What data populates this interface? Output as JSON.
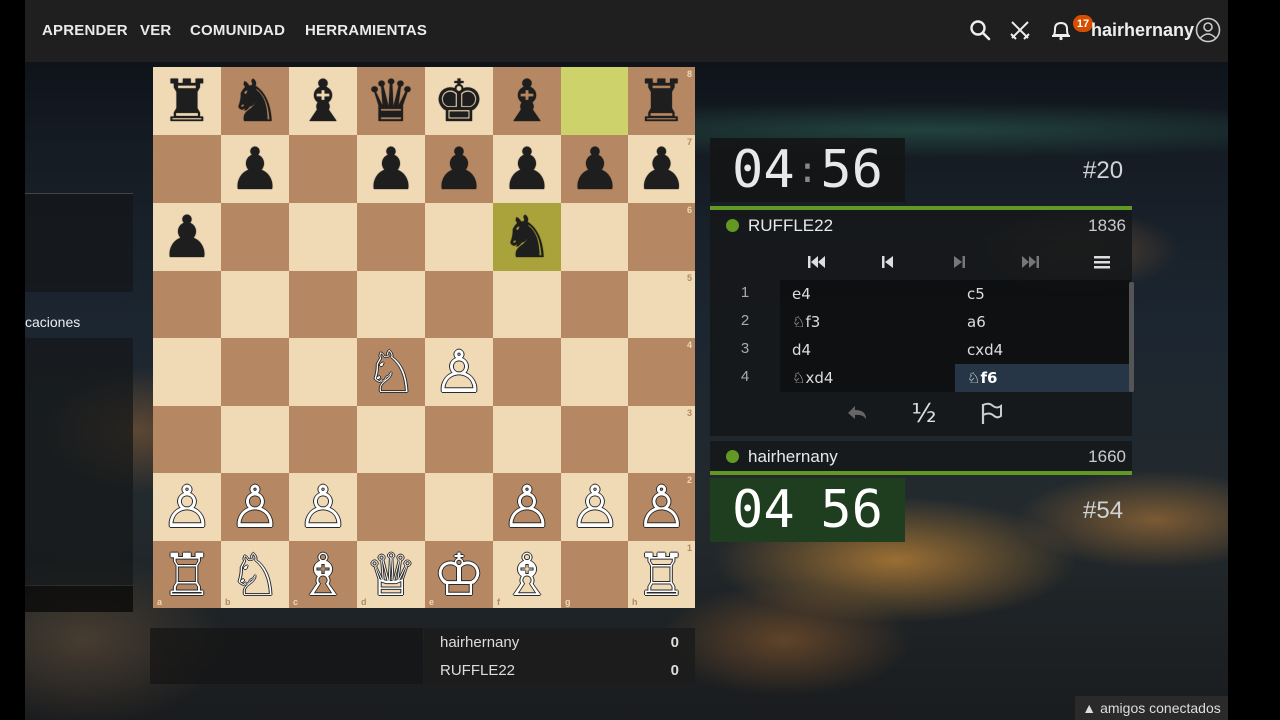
{
  "nav": {
    "items": [
      "APRENDER",
      "VER",
      "COMUNIDAD",
      "HERRAMIENTAS"
    ],
    "notifications_count": "17",
    "username": "hairhernany",
    "icons": [
      "search-icon",
      "swords-icon",
      "bell-icon",
      "user-circle-icon"
    ]
  },
  "sidebar": {
    "partial_label": "caciones"
  },
  "board": {
    "orientation": "white",
    "light_color": "#f0d9b5",
    "dark_color": "#b58863",
    "last_move_highlight": [
      "g8",
      "f6"
    ],
    "pieces": {
      "a8": "♜",
      "b8": "♞",
      "c8": "♝",
      "d8": "♛",
      "e8": "♚",
      "f8": "♝",
      "h8": "♜",
      "b7": "♟",
      "d7": "♟",
      "e7": "♟",
      "f7": "♟",
      "g7": "♟",
      "h7": "♟",
      "a6": "♟",
      "f6": "♞",
      "d4": "♘",
      "e4": "♙",
      "a2": "♙",
      "b2": "♙",
      "c2": "♙",
      "f2": "♙",
      "g2": "♙",
      "h2": "♙",
      "a1": "♖",
      "b1": "♘",
      "c1": "♗",
      "d1": "♕",
      "e1": "♔",
      "f1": "♗",
      "h1": "♖"
    }
  },
  "game": {
    "top_clock": {
      "min": "04",
      "sec": "56",
      "rank": "#20"
    },
    "bottom_clock": {
      "min": "04",
      "sec": "56",
      "rank": "#54"
    },
    "top_player": {
      "name": "RUFFLE22",
      "rating": "1836"
    },
    "bottom_player": {
      "name": "hairhernany",
      "rating": "1660"
    },
    "moves": [
      {
        "num": "1",
        "white": "e4",
        "black": "c5"
      },
      {
        "num": "2",
        "white": "♘f3",
        "black": "a6"
      },
      {
        "num": "3",
        "white": "d4",
        "black": "cxd4"
      },
      {
        "num": "4",
        "white": "♘xd4",
        "black": "♘f6"
      }
    ],
    "draw_label": "½",
    "accent": "#629924"
  },
  "score": [
    {
      "name": "hairhernany",
      "score": "0"
    },
    {
      "name": "RUFFLE22",
      "score": "0"
    }
  ],
  "footer": {
    "friends_label": "amigos conectados"
  }
}
